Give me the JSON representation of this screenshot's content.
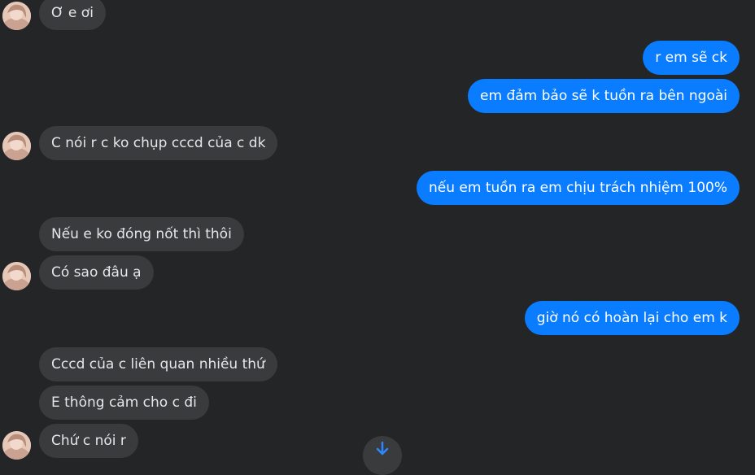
{
  "messages": [
    {
      "side": "in",
      "text": "Ơ e ơi"
    },
    {
      "side": "out",
      "text": "r em sẽ ck"
    },
    {
      "side": "out",
      "text": "em đảm bảo sẽ k tuồn ra bên ngoài"
    },
    {
      "side": "in",
      "text": "C nói r c ko chụp cccd của c dk"
    },
    {
      "side": "out",
      "text": "nếu em tuồn ra em chịu trách nhiệm 100%"
    },
    {
      "side": "in",
      "text": "Nếu e ko đóng nốt thì thôi"
    },
    {
      "side": "in",
      "text": "Có sao đâu ạ"
    },
    {
      "side": "out",
      "text": "giờ nó có hoàn lại cho em k"
    },
    {
      "side": "in",
      "text": "Cccd của c liên quan nhiều thứ"
    },
    {
      "side": "in",
      "text": "E thông cảm cho c đi"
    },
    {
      "side": "in",
      "text": "Chứ c nói r"
    }
  ],
  "icons": {
    "avatar": "contact-avatar",
    "scroll": "arrow-down-icon"
  },
  "colors": {
    "background": "#242526",
    "incoming": "#3a3b3c",
    "outgoing": "#0a7cff"
  }
}
